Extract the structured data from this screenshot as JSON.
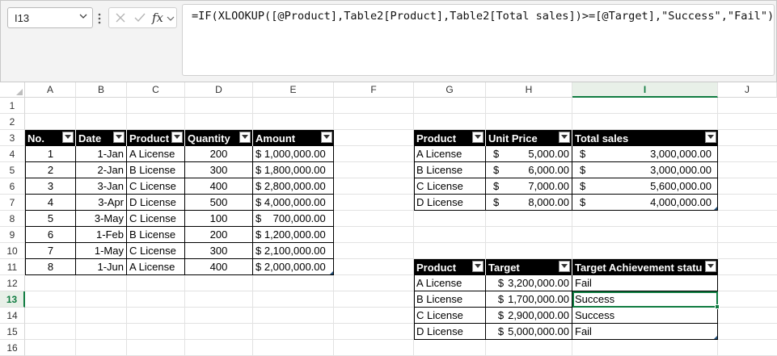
{
  "formula_bar": {
    "name_box": "I13",
    "fx_label": "fx",
    "formula": "=IF(XLOOKUP([@Product],Table2[Product],Table2[Total sales])>=[@Target],\"Success\",\"Fail\")"
  },
  "columns": [
    "A",
    "B",
    "C",
    "D",
    "E",
    "F",
    "G",
    "H",
    "I",
    "J"
  ],
  "rows": [
    "1",
    "2",
    "3",
    "4",
    "5",
    "6",
    "7",
    "8",
    "9",
    "10",
    "11",
    "12",
    "13",
    "14",
    "15",
    "16"
  ],
  "selected_cell": "I13",
  "accent_color": "#107c41",
  "table1": {
    "headers": [
      "No.",
      "Date",
      "Product",
      "Quantity",
      "Amount"
    ],
    "rows": [
      [
        "1",
        "1-Jan",
        "A License",
        "200",
        "$ 1,000,000.00"
      ],
      [
        "2",
        "2-Jan",
        "B License",
        "300",
        "$ 1,800,000.00"
      ],
      [
        "3",
        "3-Jan",
        "C License",
        "400",
        "$ 2,800,000.00"
      ],
      [
        "4",
        "3-Apr",
        "D License",
        "500",
        "$ 4,000,000.00"
      ],
      [
        "5",
        "3-May",
        "C License",
        "100",
        "$    700,000.00"
      ],
      [
        "6",
        "1-Feb",
        "B License",
        "200",
        "$ 1,200,000.00"
      ],
      [
        "7",
        "1-May",
        "C License",
        "300",
        "$ 2,100,000.00"
      ],
      [
        "8",
        "1-Jun",
        "A License",
        "400",
        "$ 2,000,000.00"
      ]
    ]
  },
  "table2": {
    "headers": [
      "Product",
      "Unit Price",
      "Total sales"
    ],
    "rows": [
      [
        "A License",
        "$",
        "5,000.00",
        "$",
        "3,000,000.00"
      ],
      [
        "B License",
        "$",
        "6,000.00",
        "$",
        "3,000,000.00"
      ],
      [
        "C License",
        "$",
        "7,000.00",
        "$",
        "5,600,000.00"
      ],
      [
        "D License",
        "$",
        "8,000.00",
        "$",
        "4,000,000.00"
      ]
    ]
  },
  "table3": {
    "headers": [
      "Product",
      "Target",
      "Target Achievement statu"
    ],
    "rows": [
      [
        "A License",
        "$",
        "3,200,000.00",
        "Fail"
      ],
      [
        "B License",
        "$",
        "1,700,000.00",
        "Success"
      ],
      [
        "C License",
        "$",
        "2,900,000.00",
        "Success"
      ],
      [
        "D License",
        "$",
        "5,000,000.00",
        "Fail"
      ]
    ]
  }
}
